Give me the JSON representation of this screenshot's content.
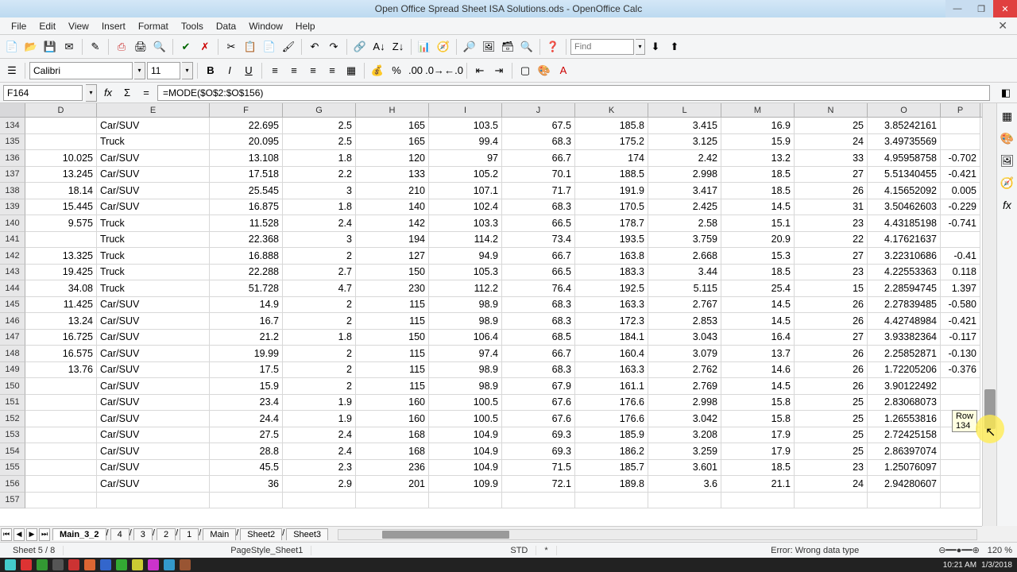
{
  "window": {
    "title": "Open Office Spread Sheet ISA Solutions.ods - OpenOffice Calc",
    "minimize": "—",
    "maximize": "❐",
    "close": "✕",
    "close_doc": "✕"
  },
  "menu": {
    "file": "File",
    "edit": "Edit",
    "view": "View",
    "insert": "Insert",
    "format": "Format",
    "tools": "Tools",
    "data": "Data",
    "window": "Window",
    "help": "Help"
  },
  "toolbar": {
    "find_placeholder": "Find",
    "arrows": {
      "down": "⬇",
      "up": "⬆"
    }
  },
  "format": {
    "font_name": "Calibri",
    "font_size": "11"
  },
  "formula": {
    "cell_ref": "F164",
    "content": "=MODE($O$2:$O$156)"
  },
  "columns": [
    "D",
    "E",
    "F",
    "G",
    "H",
    "I",
    "J",
    "K",
    "L",
    "M",
    "N",
    "O",
    "P"
  ],
  "rows": [
    {
      "n": 134,
      "D": "",
      "E": "Car/SUV",
      "F": "22.695",
      "G": "2.5",
      "H": "165",
      "I": "103.5",
      "J": "67.5",
      "K": "185.8",
      "L": "3.415",
      "M": "16.9",
      "N": "25",
      "O": "3.85242161",
      "P": ""
    },
    {
      "n": 135,
      "D": "",
      "E": "Truck",
      "F": "20.095",
      "G": "2.5",
      "H": "165",
      "I": "99.4",
      "J": "68.3",
      "K": "175.2",
      "L": "3.125",
      "M": "15.9",
      "N": "24",
      "O": "3.49735569",
      "P": ""
    },
    {
      "n": 136,
      "D": "10.025",
      "E": "Car/SUV",
      "F": "13.108",
      "G": "1.8",
      "H": "120",
      "I": "97",
      "J": "66.7",
      "K": "174",
      "L": "2.42",
      "M": "13.2",
      "N": "33",
      "O": "4.95958758",
      "P": "-0.702"
    },
    {
      "n": 137,
      "D": "13.245",
      "E": "Car/SUV",
      "F": "17.518",
      "G": "2.2",
      "H": "133",
      "I": "105.2",
      "J": "70.1",
      "K": "188.5",
      "L": "2.998",
      "M": "18.5",
      "N": "27",
      "O": "5.51340455",
      "P": "-0.421"
    },
    {
      "n": 138,
      "D": "18.14",
      "E": "Car/SUV",
      "F": "25.545",
      "G": "3",
      "H": "210",
      "I": "107.1",
      "J": "71.7",
      "K": "191.9",
      "L": "3.417",
      "M": "18.5",
      "N": "26",
      "O": "4.15652092",
      "P": "0.005"
    },
    {
      "n": 139,
      "D": "15.445",
      "E": "Car/SUV",
      "F": "16.875",
      "G": "1.8",
      "H": "140",
      "I": "102.4",
      "J": "68.3",
      "K": "170.5",
      "L": "2.425",
      "M": "14.5",
      "N": "31",
      "O": "3.50462603",
      "P": "-0.229"
    },
    {
      "n": 140,
      "D": "9.575",
      "E": "Truck",
      "F": "11.528",
      "G": "2.4",
      "H": "142",
      "I": "103.3",
      "J": "66.5",
      "K": "178.7",
      "L": "2.58",
      "M": "15.1",
      "N": "23",
      "O": "4.43185198",
      "P": "-0.741"
    },
    {
      "n": 141,
      "D": "",
      "E": "Truck",
      "F": "22.368",
      "G": "3",
      "H": "194",
      "I": "114.2",
      "J": "73.4",
      "K": "193.5",
      "L": "3.759",
      "M": "20.9",
      "N": "22",
      "O": "4.17621637",
      "P": ""
    },
    {
      "n": 142,
      "D": "13.325",
      "E": "Truck",
      "F": "16.888",
      "G": "2",
      "H": "127",
      "I": "94.9",
      "J": "66.7",
      "K": "163.8",
      "L": "2.668",
      "M": "15.3",
      "N": "27",
      "O": "3.22310686",
      "P": "-0.41"
    },
    {
      "n": 143,
      "D": "19.425",
      "E": "Truck",
      "F": "22.288",
      "G": "2.7",
      "H": "150",
      "I": "105.3",
      "J": "66.5",
      "K": "183.3",
      "L": "3.44",
      "M": "18.5",
      "N": "23",
      "O": "4.22553363",
      "P": "0.118"
    },
    {
      "n": 144,
      "D": "34.08",
      "E": "Truck",
      "F": "51.728",
      "G": "4.7",
      "H": "230",
      "I": "112.2",
      "J": "76.4",
      "K": "192.5",
      "L": "5.115",
      "M": "25.4",
      "N": "15",
      "O": "2.28594745",
      "P": "1.397"
    },
    {
      "n": 145,
      "D": "11.425",
      "E": "Car/SUV",
      "F": "14.9",
      "G": "2",
      "H": "115",
      "I": "98.9",
      "J": "68.3",
      "K": "163.3",
      "L": "2.767",
      "M": "14.5",
      "N": "26",
      "O": "2.27839485",
      "P": "-0.580"
    },
    {
      "n": 146,
      "D": "13.24",
      "E": "Car/SUV",
      "F": "16.7",
      "G": "2",
      "H": "115",
      "I": "98.9",
      "J": "68.3",
      "K": "172.3",
      "L": "2.853",
      "M": "14.5",
      "N": "26",
      "O": "4.42748984",
      "P": "-0.421"
    },
    {
      "n": 147,
      "D": "16.725",
      "E": "Car/SUV",
      "F": "21.2",
      "G": "1.8",
      "H": "150",
      "I": "106.4",
      "J": "68.5",
      "K": "184.1",
      "L": "3.043",
      "M": "16.4",
      "N": "27",
      "O": "3.93382364",
      "P": "-0.117"
    },
    {
      "n": 148,
      "D": "16.575",
      "E": "Car/SUV",
      "F": "19.99",
      "G": "2",
      "H": "115",
      "I": "97.4",
      "J": "66.7",
      "K": "160.4",
      "L": "3.079",
      "M": "13.7",
      "N": "26",
      "O": "2.25852871",
      "P": "-0.130"
    },
    {
      "n": 149,
      "D": "13.76",
      "E": "Car/SUV",
      "F": "17.5",
      "G": "2",
      "H": "115",
      "I": "98.9",
      "J": "68.3",
      "K": "163.3",
      "L": "2.762",
      "M": "14.6",
      "N": "26",
      "O": "1.72205206",
      "P": "-0.376"
    },
    {
      "n": 150,
      "D": "",
      "E": "Car/SUV",
      "F": "15.9",
      "G": "2",
      "H": "115",
      "I": "98.9",
      "J": "67.9",
      "K": "161.1",
      "L": "2.769",
      "M": "14.5",
      "N": "26",
      "O": "3.90122492",
      "P": ""
    },
    {
      "n": 151,
      "D": "",
      "E": "Car/SUV",
      "F": "23.4",
      "G": "1.9",
      "H": "160",
      "I": "100.5",
      "J": "67.6",
      "K": "176.6",
      "L": "2.998",
      "M": "15.8",
      "N": "25",
      "O": "2.83068073",
      "P": ""
    },
    {
      "n": 152,
      "D": "",
      "E": "Car/SUV",
      "F": "24.4",
      "G": "1.9",
      "H": "160",
      "I": "100.5",
      "J": "67.6",
      "K": "176.6",
      "L": "3.042",
      "M": "15.8",
      "N": "25",
      "O": "1.26553816",
      "P": ""
    },
    {
      "n": 153,
      "D": "",
      "E": "Car/SUV",
      "F": "27.5",
      "G": "2.4",
      "H": "168",
      "I": "104.9",
      "J": "69.3",
      "K": "185.9",
      "L": "3.208",
      "M": "17.9",
      "N": "25",
      "O": "2.72425158",
      "P": ""
    },
    {
      "n": 154,
      "D": "",
      "E": "Car/SUV",
      "F": "28.8",
      "G": "2.4",
      "H": "168",
      "I": "104.9",
      "J": "69.3",
      "K": "186.2",
      "L": "3.259",
      "M": "17.9",
      "N": "25",
      "O": "2.86397074",
      "P": ""
    },
    {
      "n": 155,
      "D": "",
      "E": "Car/SUV",
      "F": "45.5",
      "G": "2.3",
      "H": "236",
      "I": "104.9",
      "J": "71.5",
      "K": "185.7",
      "L": "3.601",
      "M": "18.5",
      "N": "23",
      "O": "1.25076097",
      "P": ""
    },
    {
      "n": 156,
      "D": "",
      "E": "Car/SUV",
      "F": "36",
      "G": "2.9",
      "H": "201",
      "I": "109.9",
      "J": "72.1",
      "K": "189.8",
      "L": "3.6",
      "M": "21.1",
      "N": "24",
      "O": "2.94280607",
      "P": ""
    },
    {
      "n": 157,
      "D": "",
      "E": "",
      "F": "",
      "G": "",
      "H": "",
      "I": "",
      "J": "",
      "K": "",
      "L": "",
      "M": "",
      "N": "",
      "O": "",
      "P": ""
    }
  ],
  "scroll_tip": "Row 134",
  "tabs": {
    "list": [
      "Main_3_2",
      "4",
      "3",
      "2",
      "1",
      "Main",
      "Sheet2",
      "Sheet3"
    ],
    "active_index": 0
  },
  "status": {
    "sheet": "Sheet 5 / 8",
    "pagestyle": "PageStyle_Sheet1",
    "mode": "STD",
    "dirty": "*",
    "error": "Error: Wrong data type",
    "zoom": "120 %"
  },
  "sys": {
    "time": "10:21 AM",
    "date": "1/3/2018"
  }
}
